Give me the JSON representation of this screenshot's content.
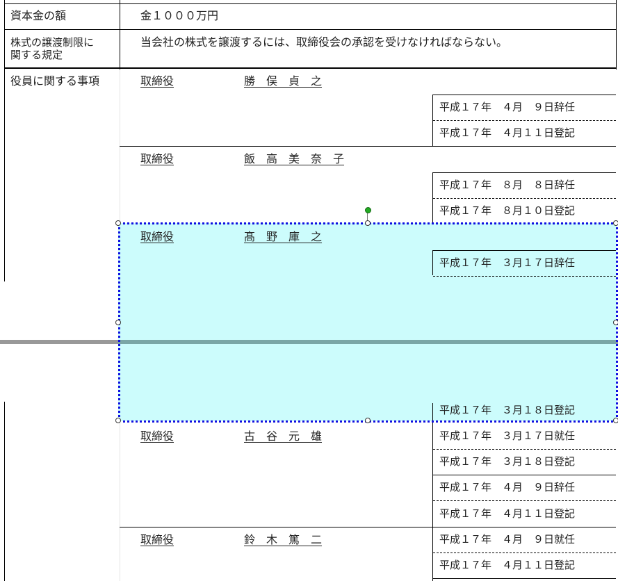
{
  "capital": {
    "label": "資本金の額",
    "value": "金１０００万円"
  },
  "transfer": {
    "label_line1": "株式の譲渡制限に",
    "label_line2": "関する規定",
    "value": "当会社の株式を譲渡するには、取締役会の承認を受けなければならない。"
  },
  "officers": {
    "label": "役員に関する事項",
    "entries": [
      {
        "role": "取締役",
        "name": "勝　俣　貞　之",
        "records": [
          "平成１７年　４月　９日辞任",
          "平成１７年　４月１１日登記"
        ]
      },
      {
        "role": "取締役",
        "name": "飯　高　美　奈　子",
        "records": [
          "平成１７年　８月　８日辞任",
          "平成１７年　８月１０日登記"
        ]
      },
      {
        "role": "取締役",
        "name": "髙　野　庫　之",
        "records": [
          "平成１７年　３月１７日辞任",
          "平成１７年　３月１８日登記"
        ]
      },
      {
        "role": "取締役",
        "name": "古　谷　元　雄",
        "records": [
          "平成１７年　３月１７日就任",
          "平成１７年　３月１８日登記",
          "平成１７年　４月　９日辞任",
          "平成１７年　４月１１日登記"
        ]
      },
      {
        "role": "取締役",
        "name": "鈴　木　篤　二",
        "records": [
          "平成１７年　４月　９日就任",
          "平成１７年　４月１１日登記"
        ]
      }
    ]
  },
  "colors": {
    "selection_fill": "#ccfcfc",
    "selection_border": "#1010e0",
    "splitter": "#999999",
    "rotate_handle": "#22aa22"
  }
}
